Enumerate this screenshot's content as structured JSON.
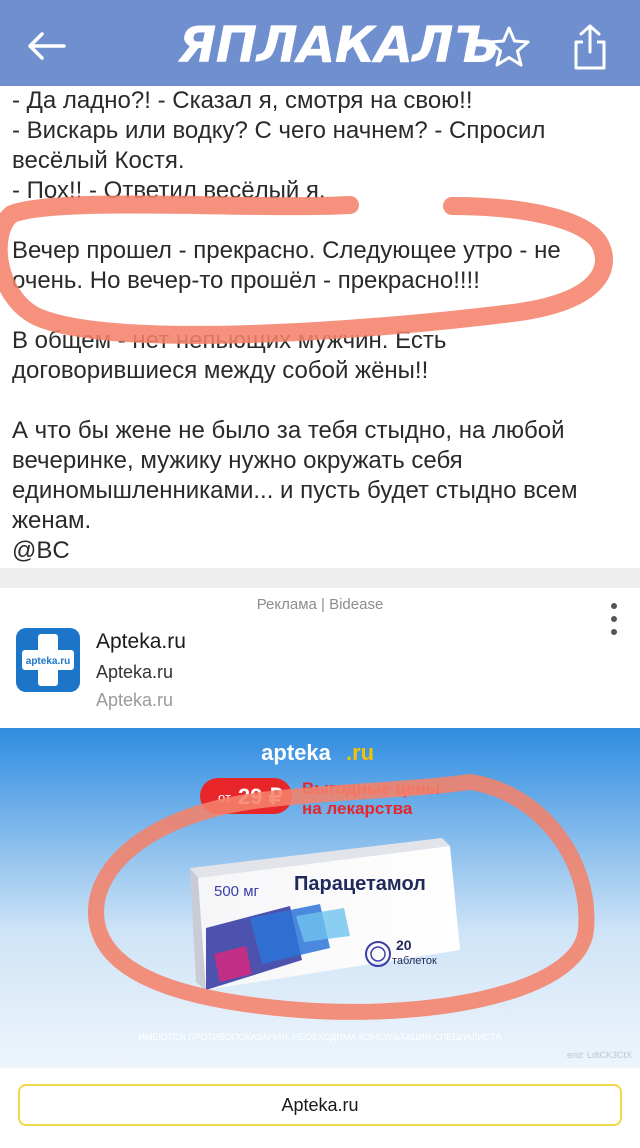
{
  "header": {
    "logo_text": "ЯПЛАКАЛЪ",
    "back_icon": "arrow-left-icon",
    "star_icon": "star-icon",
    "share_icon": "share-icon",
    "bar_color": "#6f8fcf"
  },
  "post": {
    "lines": [
      "- Да ладно?! - Сказал я, смотря на свою!!",
      "- Вискарь или водку? С чего начнем? - Спросил",
      "весёлый Костя.",
      "- Пох!! - Ответил весёлый я.",
      "Вечер прошел - прекрасно. Следующее утро - не",
      "очень. Но вечер-то прошёл - прекрасно!!!!",
      "В общем - нет непьющих мужчин. Есть",
      "договорившиеся между собой жёны!!",
      "А что бы жене не было за тебя стыдно, на любой",
      "вечеринке, мужику нужно окружать себя",
      "единомышленниками... и пусть будет стыдно всем",
      "женам.",
      "@BC"
    ]
  },
  "ad": {
    "label": "Реклама | Bidease",
    "app_name": "Apteka.ru",
    "app_subtitle": "Apteka.ru",
    "app_domain": "Apteka.ru",
    "icon_text": "apteka.ru",
    "banner": {
      "brand": "apteka",
      "brand_suffix": ".ru",
      "price_prefix": "от",
      "price": "29 ₽",
      "promo_line1": "Выгодные цены",
      "promo_line2": "на лекарства",
      "product_dose": "500 мг",
      "product_name": "Парацетамол",
      "product_count": "20",
      "product_unit": "таблеток",
      "disclaimer": "ИМЕЮТСЯ ПРОТИВОПОКАЗАНИЯ, НЕОБХОДИМА КОНСУЛЬТАЦИЯ СПЕЦИАЛИСТА",
      "erid": "erid: LdtCK3CtX"
    },
    "cta": "Apteka.ru"
  },
  "colors": {
    "highlight": "#f4826a",
    "cta_border": "#f0d84a",
    "banner_sky": "#2f8ce0"
  }
}
